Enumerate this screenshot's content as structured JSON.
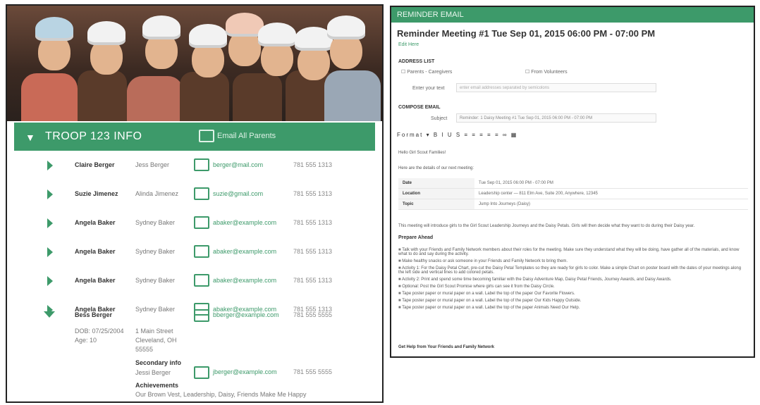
{
  "troop": {
    "header_title": "TROOP 123 INFO",
    "email_all": "Email All Parents",
    "members": [
      {
        "parent": "Claire Berger",
        "child": "Jess Berger",
        "email": "berger@mail.com",
        "phone": "781 555 1313"
      },
      {
        "parent": "Suzie Jimenez",
        "child": "Alinda Jimenez",
        "email": "suzie@gmail.com",
        "phone": "781 555 1313"
      },
      {
        "parent": "Angela Baker",
        "child": "Sydney Baker",
        "email": "abaker@example.com",
        "phone": "781 555 1313"
      },
      {
        "parent": "Angela Baker",
        "child": "Sydney Baker",
        "email": "abaker@example.com",
        "phone": "781 555 1313"
      },
      {
        "parent": "Angela Baker",
        "child": "Sydney Baker",
        "email": "abaker@example.com",
        "phone": "781 555 1313"
      },
      {
        "parent": "Angela Baker",
        "child": "Sydney Baker",
        "email": "abaker@example.com",
        "phone": "781 555 1313"
      }
    ],
    "expanded": {
      "parent": "Bess Berger",
      "email": "bberger@example.com",
      "phone": "781 555 5555",
      "dob_label": "DOB: 07/25/2004",
      "age": "Age: 10",
      "address": "1 Main Street\nCleveland, OH\n55555",
      "secondary_label": "Secondary info",
      "secondary_name": "Jessi Berger",
      "secondary_email": "jberger@example.com",
      "secondary_phone": "781 555 5555",
      "achievements_label": "Achievements",
      "achievements": "Our Brown Vest, Leadership, Daisy, Friends Make Me Happy"
    }
  },
  "reminder": {
    "panel_title": "REMINDER EMAIL",
    "title": "Reminder Meeting #1 Tue Sep 01, 2015 06:00 PM - 07:00 PM",
    "edit_link": "Edit Here",
    "address_list_label": "ADDRESS LIST",
    "to_option": "Parents - Caregivers",
    "from_option": "From Volunteers",
    "enter_text": "Enter your text",
    "enter_placeholder": "enter email addresses separated by semicolons",
    "compose_label": "COMPOSE EMAIL",
    "subject_label": "Subject",
    "subject_value": "Reminder: 1 Daisy Meeting #1 Tue Sep 01, 2015 06:00 PM - 07:00 PM",
    "toolbar_label": "Format",
    "toolbar_icons": "▾ B I U S ≡ ≡ ≡ ≡ ≡ ∞ ▦",
    "greeting": "Hello Girl Scout Families!",
    "intro": "Here are the details of our next meeting:",
    "details": [
      {
        "k": "Date",
        "v": "Tue Sep 01, 2015 06:00 PM - 07:00 PM"
      },
      {
        "k": "Location",
        "v": "Leadership center — 811 Elm Ave, Suite 200, Anywhere, 12345"
      },
      {
        "k": "Topic",
        "v": "Jump Into Journeys (Daisy)"
      }
    ],
    "body_line": "This meeting will introduce girls to the Girl Scout Leadership Journeys and the Daisy Petals. Girls will then decide what they want to do during their Daisy year.",
    "prepare_label": "Prepare Ahead",
    "bullets": [
      "Talk with your Friends and Family Network members about their roles for the meeting. Make sure they understand what they will be doing, have gather all of the materials, and know what to do and say during the activity.",
      "Make healthy snacks or ask someone in your Friends and Family Network to bring them.",
      "Activity 1: For the Daisy Petal Chart, pre-cut the Daisy Petal Templates so they are ready for girls to color. Make a simple Chart on poster board with the dates of your meetings along the left side and vertical lines to add colored petals.",
      "Activity 2: Print and spend some time becoming familiar with the Daisy Adventure Map, Daisy Petal Friends, Journey Awards, and Daisy Awards.",
      "Optional: Post the Girl Scout Promise where girls can see it from the Daisy Circle.",
      "Tape poster paper or mural paper on a wall. Label the top of the paper Our Favorite Flowers.",
      "Tape poster paper or mural paper on a wall. Label the top of the paper Our Kids Happy Outside.",
      "Tape poster paper or mural paper on a wall. Label the top of the paper Animals Need Our Help."
    ],
    "footer": "Get Help from Your Friends and Family Network"
  }
}
